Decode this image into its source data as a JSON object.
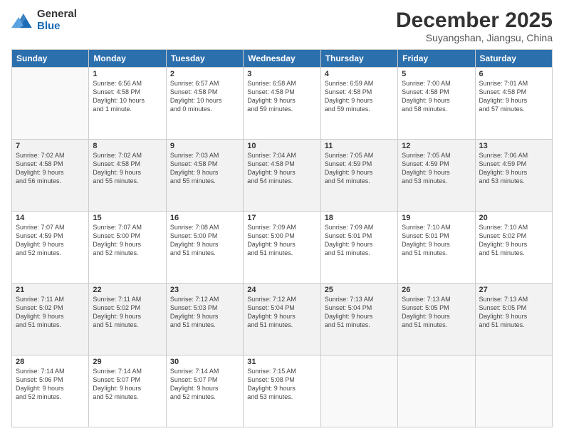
{
  "header": {
    "logo_general": "General",
    "logo_blue": "Blue",
    "title": "December 2025",
    "subtitle": "Suyangshan, Jiangsu, China"
  },
  "days_of_week": [
    "Sunday",
    "Monday",
    "Tuesday",
    "Wednesday",
    "Thursday",
    "Friday",
    "Saturday"
  ],
  "weeks": [
    [
      {
        "day": "",
        "info": ""
      },
      {
        "day": "1",
        "info": "Sunrise: 6:56 AM\nSunset: 4:58 PM\nDaylight: 10 hours\nand 1 minute."
      },
      {
        "day": "2",
        "info": "Sunrise: 6:57 AM\nSunset: 4:58 PM\nDaylight: 10 hours\nand 0 minutes."
      },
      {
        "day": "3",
        "info": "Sunrise: 6:58 AM\nSunset: 4:58 PM\nDaylight: 9 hours\nand 59 minutes."
      },
      {
        "day": "4",
        "info": "Sunrise: 6:59 AM\nSunset: 4:58 PM\nDaylight: 9 hours\nand 59 minutes."
      },
      {
        "day": "5",
        "info": "Sunrise: 7:00 AM\nSunset: 4:58 PM\nDaylight: 9 hours\nand 58 minutes."
      },
      {
        "day": "6",
        "info": "Sunrise: 7:01 AM\nSunset: 4:58 PM\nDaylight: 9 hours\nand 57 minutes."
      }
    ],
    [
      {
        "day": "7",
        "info": "Sunrise: 7:02 AM\nSunset: 4:58 PM\nDaylight: 9 hours\nand 56 minutes."
      },
      {
        "day": "8",
        "info": "Sunrise: 7:02 AM\nSunset: 4:58 PM\nDaylight: 9 hours\nand 55 minutes."
      },
      {
        "day": "9",
        "info": "Sunrise: 7:03 AM\nSunset: 4:58 PM\nDaylight: 9 hours\nand 55 minutes."
      },
      {
        "day": "10",
        "info": "Sunrise: 7:04 AM\nSunset: 4:58 PM\nDaylight: 9 hours\nand 54 minutes."
      },
      {
        "day": "11",
        "info": "Sunrise: 7:05 AM\nSunset: 4:59 PM\nDaylight: 9 hours\nand 54 minutes."
      },
      {
        "day": "12",
        "info": "Sunrise: 7:05 AM\nSunset: 4:59 PM\nDaylight: 9 hours\nand 53 minutes."
      },
      {
        "day": "13",
        "info": "Sunrise: 7:06 AM\nSunset: 4:59 PM\nDaylight: 9 hours\nand 53 minutes."
      }
    ],
    [
      {
        "day": "14",
        "info": "Sunrise: 7:07 AM\nSunset: 4:59 PM\nDaylight: 9 hours\nand 52 minutes."
      },
      {
        "day": "15",
        "info": "Sunrise: 7:07 AM\nSunset: 5:00 PM\nDaylight: 9 hours\nand 52 minutes."
      },
      {
        "day": "16",
        "info": "Sunrise: 7:08 AM\nSunset: 5:00 PM\nDaylight: 9 hours\nand 51 minutes."
      },
      {
        "day": "17",
        "info": "Sunrise: 7:09 AM\nSunset: 5:00 PM\nDaylight: 9 hours\nand 51 minutes."
      },
      {
        "day": "18",
        "info": "Sunrise: 7:09 AM\nSunset: 5:01 PM\nDaylight: 9 hours\nand 51 minutes."
      },
      {
        "day": "19",
        "info": "Sunrise: 7:10 AM\nSunset: 5:01 PM\nDaylight: 9 hours\nand 51 minutes."
      },
      {
        "day": "20",
        "info": "Sunrise: 7:10 AM\nSunset: 5:02 PM\nDaylight: 9 hours\nand 51 minutes."
      }
    ],
    [
      {
        "day": "21",
        "info": "Sunrise: 7:11 AM\nSunset: 5:02 PM\nDaylight: 9 hours\nand 51 minutes."
      },
      {
        "day": "22",
        "info": "Sunrise: 7:11 AM\nSunset: 5:02 PM\nDaylight: 9 hours\nand 51 minutes."
      },
      {
        "day": "23",
        "info": "Sunrise: 7:12 AM\nSunset: 5:03 PM\nDaylight: 9 hours\nand 51 minutes."
      },
      {
        "day": "24",
        "info": "Sunrise: 7:12 AM\nSunset: 5:04 PM\nDaylight: 9 hours\nand 51 minutes."
      },
      {
        "day": "25",
        "info": "Sunrise: 7:13 AM\nSunset: 5:04 PM\nDaylight: 9 hours\nand 51 minutes."
      },
      {
        "day": "26",
        "info": "Sunrise: 7:13 AM\nSunset: 5:05 PM\nDaylight: 9 hours\nand 51 minutes."
      },
      {
        "day": "27",
        "info": "Sunrise: 7:13 AM\nSunset: 5:05 PM\nDaylight: 9 hours\nand 51 minutes."
      }
    ],
    [
      {
        "day": "28",
        "info": "Sunrise: 7:14 AM\nSunset: 5:06 PM\nDaylight: 9 hours\nand 52 minutes."
      },
      {
        "day": "29",
        "info": "Sunrise: 7:14 AM\nSunset: 5:07 PM\nDaylight: 9 hours\nand 52 minutes."
      },
      {
        "day": "30",
        "info": "Sunrise: 7:14 AM\nSunset: 5:07 PM\nDaylight: 9 hours\nand 52 minutes."
      },
      {
        "day": "31",
        "info": "Sunrise: 7:15 AM\nSunset: 5:08 PM\nDaylight: 9 hours\nand 53 minutes."
      },
      {
        "day": "",
        "info": ""
      },
      {
        "day": "",
        "info": ""
      },
      {
        "day": "",
        "info": ""
      }
    ]
  ]
}
